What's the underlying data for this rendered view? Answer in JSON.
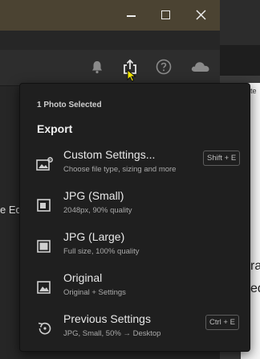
{
  "background_text": {
    "left_partial": "e Ed",
    "right_tab_partial": "ite",
    "right_partial_1": "ra",
    "right_partial_2": "ed"
  },
  "window_controls": {
    "minimize_icon": "minimize-icon",
    "maximize_icon": "maximize-icon",
    "close_icon": "close-icon"
  },
  "toolbar": {
    "icons": [
      "bell-icon",
      "share-export-icon",
      "help-icon",
      "cloud-icon"
    ]
  },
  "export_menu": {
    "selection_count": "1 Photo Selected",
    "title": "Export",
    "items": [
      {
        "label": "Custom Settings...",
        "subtitle": "Choose file type, sizing and more",
        "shortcut": "Shift + E",
        "icon": "custom-settings-icon"
      },
      {
        "label": "JPG (Small)",
        "subtitle": "2048px, 90% quality",
        "shortcut": "",
        "icon": "jpg-small-icon"
      },
      {
        "label": "JPG (Large)",
        "subtitle": "Full size, 100% quality",
        "shortcut": "",
        "icon": "jpg-large-icon"
      },
      {
        "label": "Original",
        "subtitle": "Original + Settings",
        "shortcut": "",
        "icon": "original-image-icon"
      },
      {
        "label": "Previous Settings",
        "subtitle": "JPG, Small, 50% → Desktop",
        "shortcut": "Ctrl + E",
        "icon": "previous-settings-icon"
      }
    ]
  },
  "colors": {
    "title_bar": "#4b4332",
    "menu_bg": "#1f1f1f",
    "toolbar_bg": "#2d2d2d",
    "cursor": "#f2e600"
  }
}
